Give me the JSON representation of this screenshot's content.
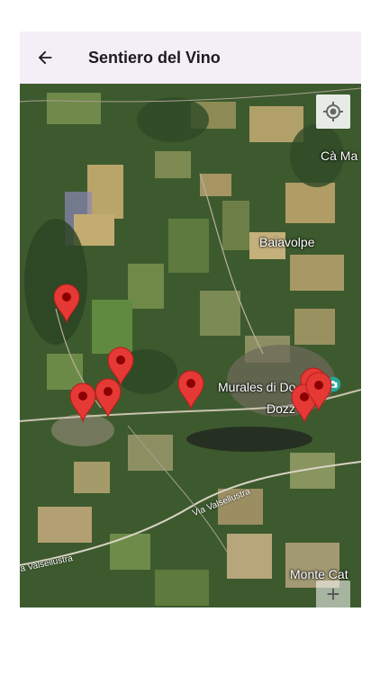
{
  "appbar": {
    "title": "Sentiero del Vino",
    "back_icon": "arrow-back-icon"
  },
  "map": {
    "controls": {
      "locate_icon": "my-location-icon",
      "zoom_in_label": "+"
    },
    "place_labels": {
      "ca_ma": "Cà Ma",
      "baiavolpe": "Baiavolpe",
      "murales": "Murales di Do",
      "dozza": "Dozz",
      "monte": "Monte Cat"
    },
    "road_labels": {
      "valsellustra_1": "Via Valsellustra",
      "valsellustra_2": "a Valsellustra"
    },
    "marker_color": "#e53935",
    "marker_count": 8,
    "poi_icon": "camera-icon"
  }
}
